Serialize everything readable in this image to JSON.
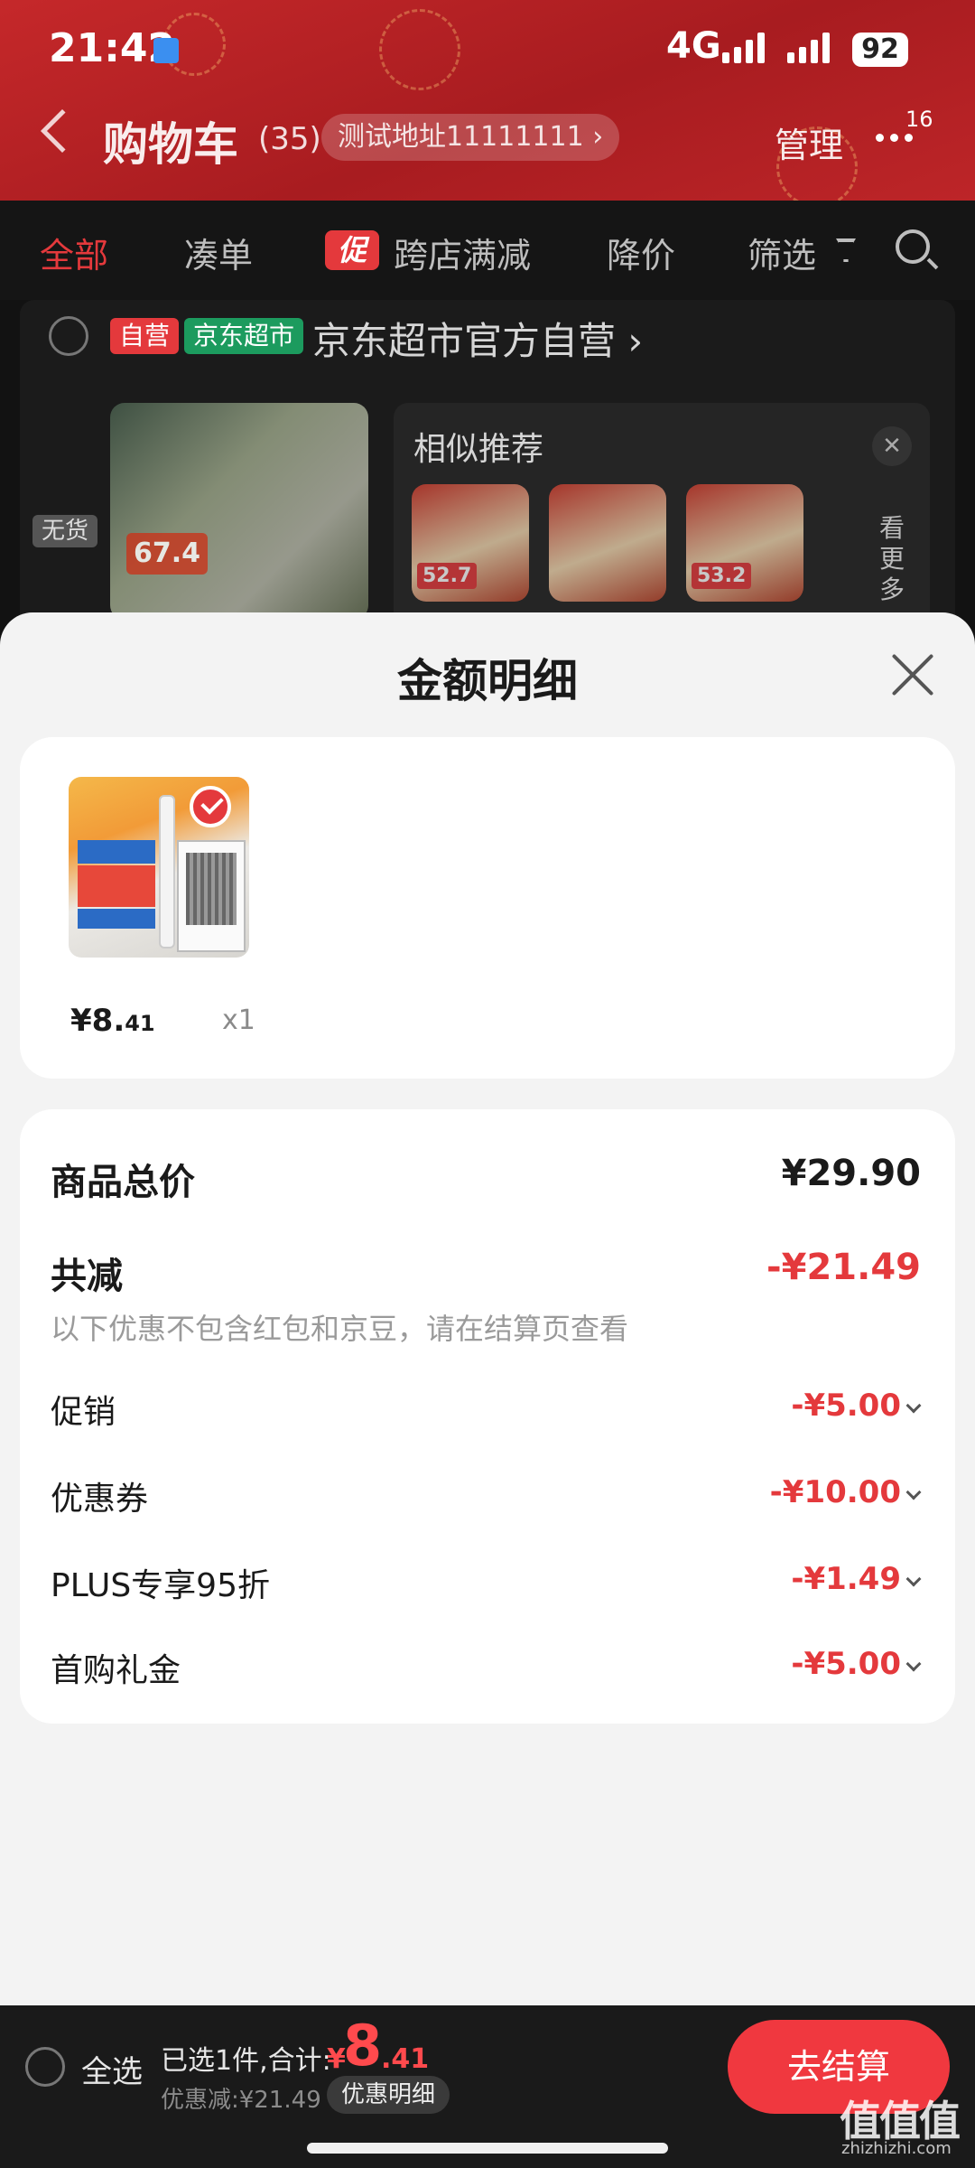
{
  "status_bar": {
    "time": "21:42",
    "network": "4G",
    "battery": "92"
  },
  "nav": {
    "title": "购物车",
    "count": "(35)",
    "address": "测试地址11111111 ›",
    "manage": "管理",
    "more_badge": "16"
  },
  "tabs": [
    {
      "label": "全部"
    },
    {
      "label": "凑单"
    },
    {
      "label": "跨店满减",
      "tag": "促"
    },
    {
      "label": "降价"
    },
    {
      "label": "筛选"
    }
  ],
  "store": {
    "tag_self": "自营",
    "tag_jd": "京东超市",
    "name": "京东超市官方自营 ›",
    "out_of_stock": "无货",
    "product_price_tag": "67.4",
    "similar_title": "相似推荐",
    "similar_items": [
      {
        "price": "52.7"
      },
      {
        "price": ""
      },
      {
        "price": "53.2"
      }
    ],
    "see_more": "看更多"
  },
  "sheet": {
    "title": "金额明细",
    "item": {
      "price_int": "¥8.",
      "price_dec": "41",
      "qty": "x1"
    },
    "goods_total_label": "商品总价",
    "goods_total_value": "¥29.90",
    "total_discount_label": "共减",
    "total_discount_value": "-¥21.49",
    "note": "以下优惠不包含红包和京豆，请在结算页查看",
    "discounts": [
      {
        "label": "促销",
        "value": "-¥5.00"
      },
      {
        "label": "优惠券",
        "value": "-¥10.00"
      },
      {
        "label": "PLUS专享95折",
        "value": "-¥1.49"
      },
      {
        "label": "首购礼金",
        "value": "-¥5.00"
      }
    ]
  },
  "bottom_bar": {
    "select_all": "全选",
    "selected_text": "已选1件,合计:",
    "total_symbol": "¥",
    "total_int": "8",
    "total_dec": ".41",
    "discount_text": "优惠减:¥21.49",
    "detail_button": "优惠明细",
    "checkout_button": "去结算"
  },
  "watermark": {
    "text": "值值值",
    "site": "zhizhizhi.com"
  },
  "colors": {
    "accent": "#e4393c",
    "header": "#b81f24",
    "checkout": "#f0383f"
  }
}
